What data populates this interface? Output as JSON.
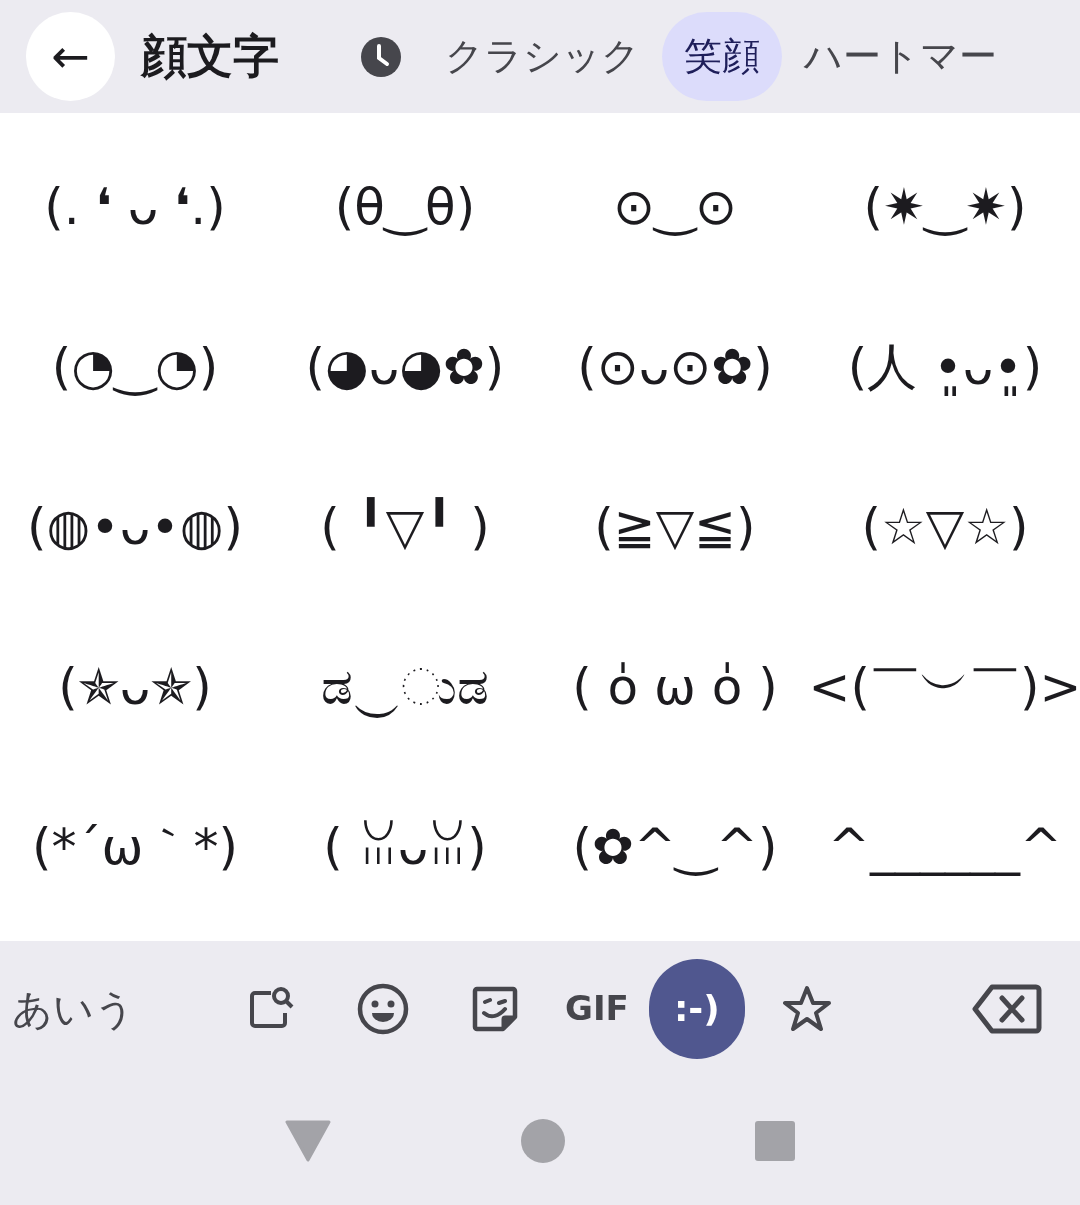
{
  "header": {
    "back_label": "←",
    "title": "顔文字"
  },
  "tabs": [
    {
      "kind": "recent",
      "selected": false
    },
    {
      "kind": "text",
      "label": "クラシック",
      "selected": false
    },
    {
      "kind": "text",
      "label": "笑顔",
      "selected": true
    },
    {
      "kind": "text",
      "label": "ハートマー",
      "selected": false
    }
  ],
  "kaomoji": [
    "(. ❛ ᴗ ❛.)",
    "(θ‿θ)",
    "⊙‿⊙",
    "(✷‿✷)",
    "(◔‿◔)",
    "(◕ᴗ◕✿)",
    "(⊙ᴗ⊙✿)",
    "(人 •͈ᴗ•͈)",
    "(◍•ᴗ•◍)",
    "( ╹▽╹ )",
    "(≧▽≦)",
    "(☆▽☆)",
    "(✯ᴗ✯)",
    "ಡ‿ುಡ",
    "( o̍ ω o̍ )",
    "<(￣︶￣)>",
    "(*´ω｀*)",
    "( ꈍᴗꈍ)",
    "(✿^‿^)",
    "^______^"
  ],
  "toolbar": [
    {
      "kind": "text",
      "label": "あいう",
      "selected": false
    },
    {
      "kind": "search",
      "selected": false
    },
    {
      "kind": "emoji",
      "selected": false
    },
    {
      "kind": "sticker",
      "selected": false
    },
    {
      "kind": "gif",
      "label": "GIF",
      "selected": false
    },
    {
      "kind": "kaomoji",
      "label": ":-)",
      "selected": true
    },
    {
      "kind": "favorite",
      "selected": false
    },
    {
      "kind": "delete",
      "selected": false
    }
  ]
}
